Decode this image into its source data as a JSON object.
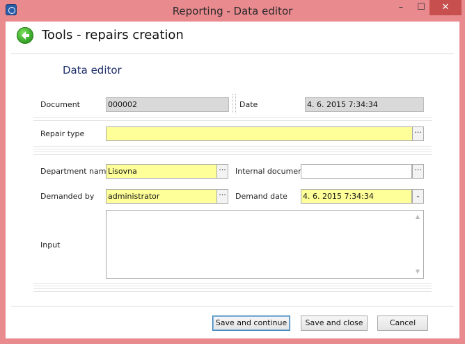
{
  "window": {
    "title": "Reporting - Data editor",
    "controls": {
      "minimize": "–",
      "maximize": "☐",
      "close": "✕"
    }
  },
  "header": {
    "title": "Tools - repairs creation",
    "back_icon": "back-arrow-icon"
  },
  "section": {
    "title": "Data editor"
  },
  "form": {
    "document": {
      "label": "Document",
      "value": "000002"
    },
    "date": {
      "label": "Date",
      "value": "4. 6. 2015 7:34:34"
    },
    "repair_type": {
      "label": "Repair type",
      "value": "",
      "button": "···"
    },
    "department": {
      "label": "Department name",
      "value": "Lisovna",
      "button": "···"
    },
    "internal_doc": {
      "label": "Internal document",
      "value": "",
      "button": "···"
    },
    "demanded_by": {
      "label": "Demanded by",
      "value": "administrator",
      "button": "···"
    },
    "demand_date": {
      "label": "Demand date",
      "value": "4. 6. 2015 7:34:34",
      "button": "⌄"
    },
    "input": {
      "label": "Input",
      "value": ""
    }
  },
  "footer": {
    "save_continue": "Save and continue",
    "save_close": "Save and close",
    "cancel": "Cancel"
  },
  "colors": {
    "required_field": "#ffff99",
    "readonly_field": "#d9d9d9",
    "close_button": "#c7504f"
  }
}
